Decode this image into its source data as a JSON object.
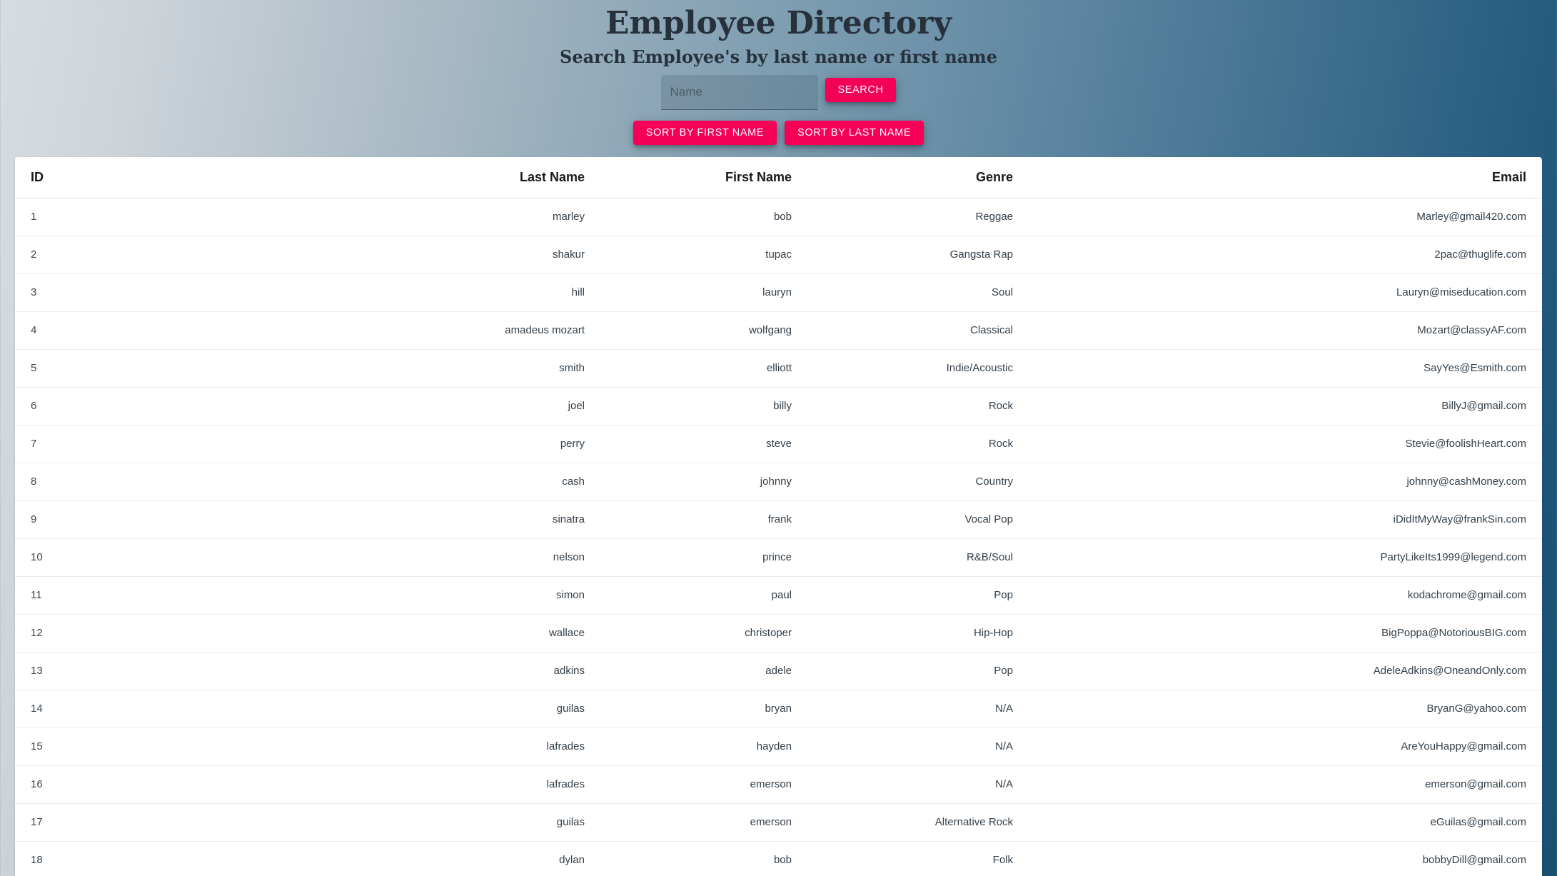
{
  "header": {
    "title": "Employee Directory",
    "subtitle": "Search Employee's by last name or first name"
  },
  "search": {
    "placeholder": "Name",
    "value": "",
    "search_label": "SEARCH"
  },
  "sort": {
    "first_name_label": "SORT BY FIRST NAME",
    "last_name_label": "SORT BY LAST NAME"
  },
  "colors": {
    "accent": "#f50057",
    "background_start": "#d7dce0",
    "background_end": "#17506f",
    "card": "#ffffff",
    "text": "#34404a"
  },
  "table": {
    "columns": [
      "ID",
      "Last Name",
      "First Name",
      "Genre",
      "Email"
    ],
    "rows": [
      {
        "id": "1",
        "last": "marley",
        "first": "bob",
        "genre": "Reggae",
        "email": "Marley@gmail420.com"
      },
      {
        "id": "2",
        "last": "shakur",
        "first": "tupac",
        "genre": "Gangsta Rap",
        "email": "2pac@thuglife.com"
      },
      {
        "id": "3",
        "last": "hill",
        "first": "lauryn",
        "genre": "Soul",
        "email": "Lauryn@miseducation.com"
      },
      {
        "id": "4",
        "last": "amadeus mozart",
        "first": "wolfgang",
        "genre": "Classical",
        "email": "Mozart@classyAF.com"
      },
      {
        "id": "5",
        "last": "smith",
        "first": "elliott",
        "genre": "Indie/Acoustic",
        "email": "SayYes@Esmith.com"
      },
      {
        "id": "6",
        "last": "joel",
        "first": "billy",
        "genre": "Rock",
        "email": "BillyJ@gmail.com"
      },
      {
        "id": "7",
        "last": "perry",
        "first": "steve",
        "genre": "Rock",
        "email": "Stevie@foolishHeart.com"
      },
      {
        "id": "8",
        "last": "cash",
        "first": "johnny",
        "genre": "Country",
        "email": "johnny@cashMoney.com"
      },
      {
        "id": "9",
        "last": "sinatra",
        "first": "frank",
        "genre": "Vocal Pop",
        "email": "iDidItMyWay@frankSin.com"
      },
      {
        "id": "10",
        "last": "nelson",
        "first": "prince",
        "genre": "R&B/Soul",
        "email": "PartyLikeIts1999@legend.com"
      },
      {
        "id": "11",
        "last": "simon",
        "first": "paul",
        "genre": "Pop",
        "email": "kodachrome@gmail.com"
      },
      {
        "id": "12",
        "last": "wallace",
        "first": "christoper",
        "genre": "Hip-Hop",
        "email": "BigPoppa@NotoriousBIG.com"
      },
      {
        "id": "13",
        "last": "adkins",
        "first": "adele",
        "genre": "Pop",
        "email": "AdeleAdkins@OneandOnly.com"
      },
      {
        "id": "14",
        "last": "guilas",
        "first": "bryan",
        "genre": "N/A",
        "email": "BryanG@yahoo.com"
      },
      {
        "id": "15",
        "last": "lafrades",
        "first": "hayden",
        "genre": "N/A",
        "email": "AreYouHappy@gmail.com"
      },
      {
        "id": "16",
        "last": "lafrades",
        "first": "emerson",
        "genre": "N/A",
        "email": "emerson@gmail.com"
      },
      {
        "id": "17",
        "last": "guilas",
        "first": "emerson",
        "genre": "Alternative Rock",
        "email": "eGuilas@gmail.com"
      },
      {
        "id": "18",
        "last": "dylan",
        "first": "bob",
        "genre": "Folk",
        "email": "bobbyDill@gmail.com"
      }
    ]
  }
}
